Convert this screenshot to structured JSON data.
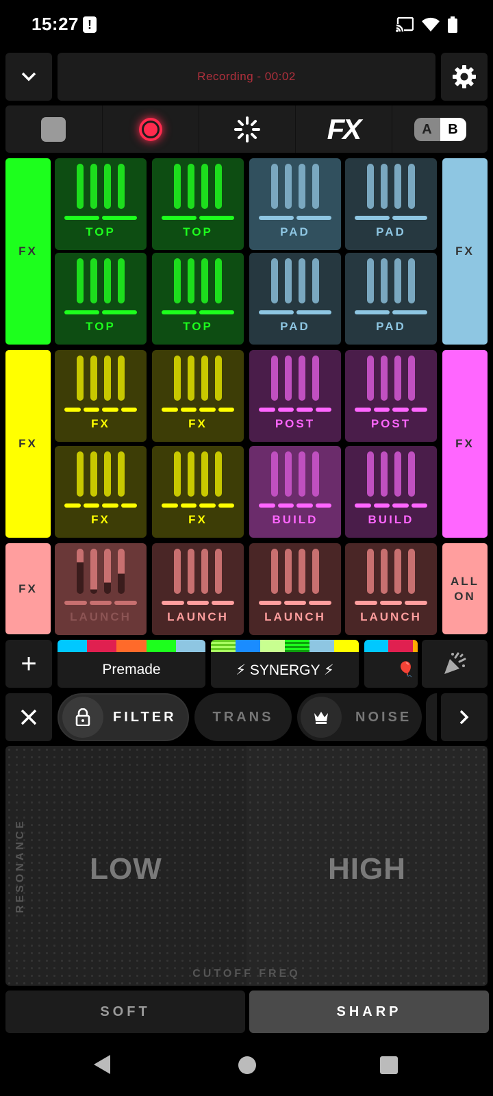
{
  "status_bar": {
    "time": "15:27",
    "notif_glyph": "!"
  },
  "top_bar": {
    "recording_text": "Recording - 00:02"
  },
  "controls": {
    "fx_label": "FX",
    "ab_a": "A",
    "ab_b": "B"
  },
  "side_buttons": {
    "top_left": "FX",
    "top_right": "FX",
    "mid_left": "FX",
    "mid_right": "FX",
    "bottom_left": "FX",
    "bottom_right_line1": "ALL",
    "bottom_right_line2": "ON"
  },
  "pads": [
    {
      "label": "TOP"
    },
    {
      "label": "TOP"
    },
    {
      "label": "PAD"
    },
    {
      "label": "PAD"
    },
    {
      "label": "TOP"
    },
    {
      "label": "TOP"
    },
    {
      "label": "PAD"
    },
    {
      "label": "PAD"
    },
    {
      "label": "FX"
    },
    {
      "label": "FX"
    },
    {
      "label": "POST"
    },
    {
      "label": "POST"
    },
    {
      "label": "FX"
    },
    {
      "label": "FX"
    },
    {
      "label": "BUILD"
    },
    {
      "label": "BUILD"
    },
    {
      "label": "LAUNCH"
    },
    {
      "label": "LAUNCH"
    },
    {
      "label": "LAUNCH"
    },
    {
      "label": "LAUNCH"
    }
  ],
  "presets": {
    "plus": "+",
    "items": [
      {
        "label": "Premade"
      },
      {
        "label": "⚡ SYNERGY ⚡"
      },
      {
        "label": "🎈"
      }
    ]
  },
  "effects": {
    "tabs": [
      {
        "label": "FILTER"
      },
      {
        "label": "TRANS"
      },
      {
        "label": "NOISE"
      }
    ]
  },
  "xy_pad": {
    "low": "LOW",
    "high": "HIGH",
    "y_axis": "RESONANCE",
    "x_axis": "CUTOFF FREQ"
  },
  "modes": {
    "soft": "SOFT",
    "sharp": "SHARP"
  },
  "colors": {
    "green": "#1dff1d",
    "blue": "#8ec6e2",
    "yellow": "#ffff00",
    "magenta": "#ff66ff",
    "salmon": "#ff9e9e",
    "record": "#ff2b4e"
  }
}
